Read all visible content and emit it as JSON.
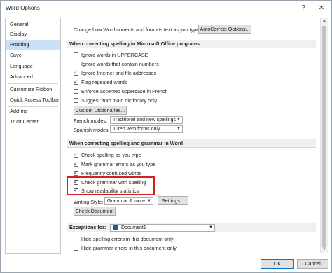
{
  "window": {
    "title": "Word Options",
    "help": "?",
    "close": "✕"
  },
  "sidebar": {
    "items": [
      {
        "label": "General"
      },
      {
        "label": "Display"
      },
      {
        "label": "Proofing"
      },
      {
        "label": "Save"
      },
      {
        "label": "Language"
      },
      {
        "label": "Advanced"
      },
      {
        "label": "Customize Ribbon"
      },
      {
        "label": "Quick Access Toolbar"
      },
      {
        "label": "Add-ins"
      },
      {
        "label": "Trust Center"
      }
    ],
    "selected": "Proofing"
  },
  "autocorrect": {
    "text": "Change how Word corrects and formats text as you type:",
    "button": "AutoCorrect Options..."
  },
  "office_section": {
    "title": "When correcting spelling in Microsoft Office programs",
    "options": [
      {
        "label": "Ignore words in UPPERCASE",
        "checked": false
      },
      {
        "label": "Ignore words that contain numbers",
        "checked": false
      },
      {
        "label": "Ignore Internet and file addresses",
        "checked": true
      },
      {
        "label": "Flag repeated words",
        "checked": true
      },
      {
        "label": "Enforce accented uppercase in French",
        "checked": false
      },
      {
        "label": "Suggest from main dictionary only",
        "checked": false
      }
    ],
    "custom_dict_button": "Custom Dictionaries...",
    "french_modes_label": "French modes:",
    "french_modes_value": "Traditional and new spellings",
    "spanish_modes_label": "Spanish modes:",
    "spanish_modes_value": "Tuteo verb forms only"
  },
  "word_section": {
    "title": "When correcting spelling and grammar in Word",
    "options": [
      {
        "label": "Check spelling as you type",
        "checked": true
      },
      {
        "label": "Mark grammar errors as you type",
        "checked": true
      },
      {
        "label": "Frequently confused words",
        "checked": true
      },
      {
        "label": "Check grammar with spelling",
        "checked": true
      },
      {
        "label": "Show readability statistics",
        "checked": true
      }
    ],
    "writing_style_label": "Writing Style:",
    "writing_style_value": "Grammar & more",
    "settings_button": "Settings...",
    "check_document_button": "Check Document"
  },
  "exceptions": {
    "label": "Exceptions for:",
    "document": "Document1",
    "options": [
      {
        "label": "Hide spelling errors in this document only",
        "checked": false
      },
      {
        "label": "Hide grammar errors in this document only",
        "checked": false
      }
    ]
  },
  "footer": {
    "ok": "OK",
    "cancel": "Cancel"
  },
  "colors": {
    "selected_bg": "#c9e0f7",
    "highlight": "#d42020",
    "accent": "#0078d7"
  }
}
